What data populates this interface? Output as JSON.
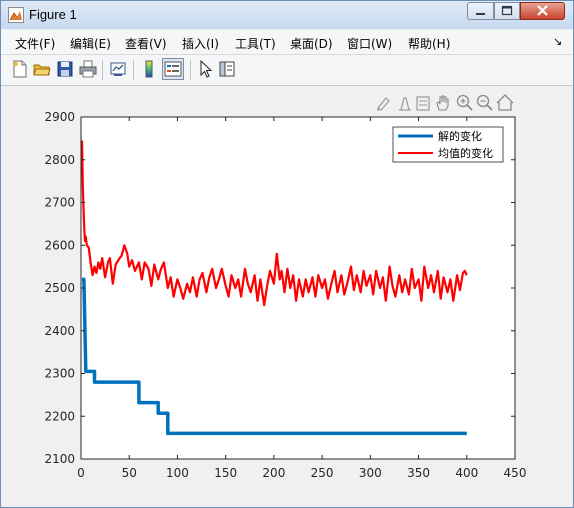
{
  "window": {
    "title": "Figure 1"
  },
  "menu": {
    "items": [
      {
        "label": "文件(F)"
      },
      {
        "label": "编辑(E)"
      },
      {
        "label": "查看(V)"
      },
      {
        "label": "插入(I)"
      },
      {
        "label": "工具(T)"
      },
      {
        "label": "桌面(D)"
      },
      {
        "label": "窗口(W)"
      },
      {
        "label": "帮助(H)"
      }
    ]
  },
  "toolbar": {
    "icons": [
      "new-figure-icon",
      "open-file-icon",
      "save-icon",
      "print-icon",
      "link-plot-icon",
      "colorbar-icon",
      "legend-icon",
      "pointer-icon",
      "property-editor-icon"
    ]
  },
  "axes_toolbar": {
    "icons": [
      "brush-icon",
      "data-cursor-icon",
      "insert-legend-icon",
      "pan-icon",
      "zoom-in-icon",
      "zoom-out-icon",
      "home-icon"
    ]
  },
  "colors": {
    "series1": "#0072bd",
    "series2": "#ff0000"
  },
  "chart_data": {
    "type": "line",
    "xlim": [
      0,
      450
    ],
    "ylim": [
      2100,
      2900
    ],
    "xticks": [
      0,
      50,
      100,
      150,
      200,
      250,
      300,
      350,
      400,
      450
    ],
    "yticks": [
      2100,
      2200,
      2300,
      2400,
      2500,
      2600,
      2700,
      2800,
      2900
    ],
    "grid": false,
    "legend_position": "top-right",
    "series": [
      {
        "name": "解的变化",
        "color": "#0072bd",
        "points": [
          [
            1,
            2520
          ],
          [
            3,
            2520
          ],
          [
            5,
            2305
          ],
          [
            14,
            2305
          ],
          [
            14,
            2280
          ],
          [
            60,
            2280
          ],
          [
            60,
            2232
          ],
          [
            80,
            2232
          ],
          [
            80,
            2207
          ],
          [
            90,
            2207
          ],
          [
            90,
            2160
          ],
          [
            400,
            2160
          ]
        ]
      },
      {
        "name": "均值的变化",
        "color": "#ff0000",
        "x_start": 1,
        "x_end": 400,
        "points": [
          [
            1,
            2845
          ],
          [
            2,
            2730
          ],
          [
            3,
            2660
          ],
          [
            4,
            2610
          ],
          [
            5,
            2620
          ],
          [
            6,
            2600
          ],
          [
            8,
            2595
          ],
          [
            10,
            2560
          ],
          [
            12,
            2530
          ],
          [
            14,
            2550
          ],
          [
            16,
            2535
          ],
          [
            18,
            2560
          ],
          [
            20,
            2545
          ],
          [
            22,
            2570
          ],
          [
            25,
            2525
          ],
          [
            28,
            2560
          ],
          [
            30,
            2570
          ],
          [
            33,
            2510
          ],
          [
            36,
            2555
          ],
          [
            40,
            2570
          ],
          [
            42,
            2575
          ],
          [
            45,
            2600
          ],
          [
            48,
            2580
          ],
          [
            50,
            2550
          ],
          [
            53,
            2565
          ],
          [
            56,
            2540
          ],
          [
            60,
            2560
          ],
          [
            63,
            2520
          ],
          [
            66,
            2560
          ],
          [
            70,
            2545
          ],
          [
            73,
            2505
          ],
          [
            76,
            2555
          ],
          [
            80,
            2520
          ],
          [
            83,
            2545
          ],
          [
            86,
            2560
          ],
          [
            90,
            2500
          ],
          [
            93,
            2525
          ],
          [
            96,
            2480
          ],
          [
            100,
            2520
          ],
          [
            103,
            2500
          ],
          [
            106,
            2475
          ],
          [
            110,
            2510
          ],
          [
            113,
            2490
          ],
          [
            116,
            2525
          ],
          [
            120,
            2480
          ],
          [
            123,
            2520
          ],
          [
            126,
            2535
          ],
          [
            130,
            2490
          ],
          [
            133,
            2525
          ],
          [
            136,
            2545
          ],
          [
            140,
            2500
          ],
          [
            143,
            2520
          ],
          [
            146,
            2545
          ],
          [
            150,
            2505
          ],
          [
            153,
            2480
          ],
          [
            156,
            2530
          ],
          [
            160,
            2500
          ],
          [
            163,
            2520
          ],
          [
            166,
            2480
          ],
          [
            170,
            2545
          ],
          [
            173,
            2510
          ],
          [
            176,
            2490
          ],
          [
            180,
            2530
          ],
          [
            183,
            2470
          ],
          [
            186,
            2520
          ],
          [
            190,
            2460
          ],
          [
            193,
            2505
          ],
          [
            196,
            2540
          ],
          [
            200,
            2510
          ],
          [
            203,
            2580
          ],
          [
            206,
            2520
          ],
          [
            208,
            2540
          ],
          [
            211,
            2490
          ],
          [
            214,
            2545
          ],
          [
            217,
            2500
          ],
          [
            220,
            2530
          ],
          [
            223,
            2470
          ],
          [
            226,
            2520
          ],
          [
            230,
            2480
          ],
          [
            233,
            2520
          ],
          [
            236,
            2490
          ],
          [
            240,
            2525
          ],
          [
            243,
            2480
          ],
          [
            246,
            2530
          ],
          [
            250,
            2500
          ],
          [
            253,
            2520
          ],
          [
            256,
            2475
          ],
          [
            260,
            2515
          ],
          [
            263,
            2540
          ],
          [
            266,
            2490
          ],
          [
            270,
            2530
          ],
          [
            273,
            2485
          ],
          [
            276,
            2510
          ],
          [
            280,
            2550
          ],
          [
            283,
            2495
          ],
          [
            286,
            2530
          ],
          [
            290,
            2490
          ],
          [
            293,
            2540
          ],
          [
            296,
            2505
          ],
          [
            300,
            2530
          ],
          [
            303,
            2485
          ],
          [
            306,
            2540
          ],
          [
            310,
            2500
          ],
          [
            313,
            2525
          ],
          [
            316,
            2470
          ],
          [
            320,
            2550
          ],
          [
            323,
            2505
          ],
          [
            326,
            2480
          ],
          [
            330,
            2530
          ],
          [
            333,
            2490
          ],
          [
            336,
            2520
          ],
          [
            340,
            2485
          ],
          [
            343,
            2545
          ],
          [
            346,
            2500
          ],
          [
            350,
            2520
          ],
          [
            353,
            2470
          ],
          [
            356,
            2550
          ],
          [
            360,
            2500
          ],
          [
            363,
            2530
          ],
          [
            366,
            2490
          ],
          [
            370,
            2540
          ],
          [
            373,
            2475
          ],
          [
            376,
            2525
          ],
          [
            380,
            2490
          ],
          [
            383,
            2520
          ],
          [
            386,
            2470
          ],
          [
            390,
            2530
          ],
          [
            393,
            2495
          ],
          [
            396,
            2535
          ],
          [
            398,
            2540
          ],
          [
            400,
            2530
          ]
        ]
      }
    ]
  }
}
